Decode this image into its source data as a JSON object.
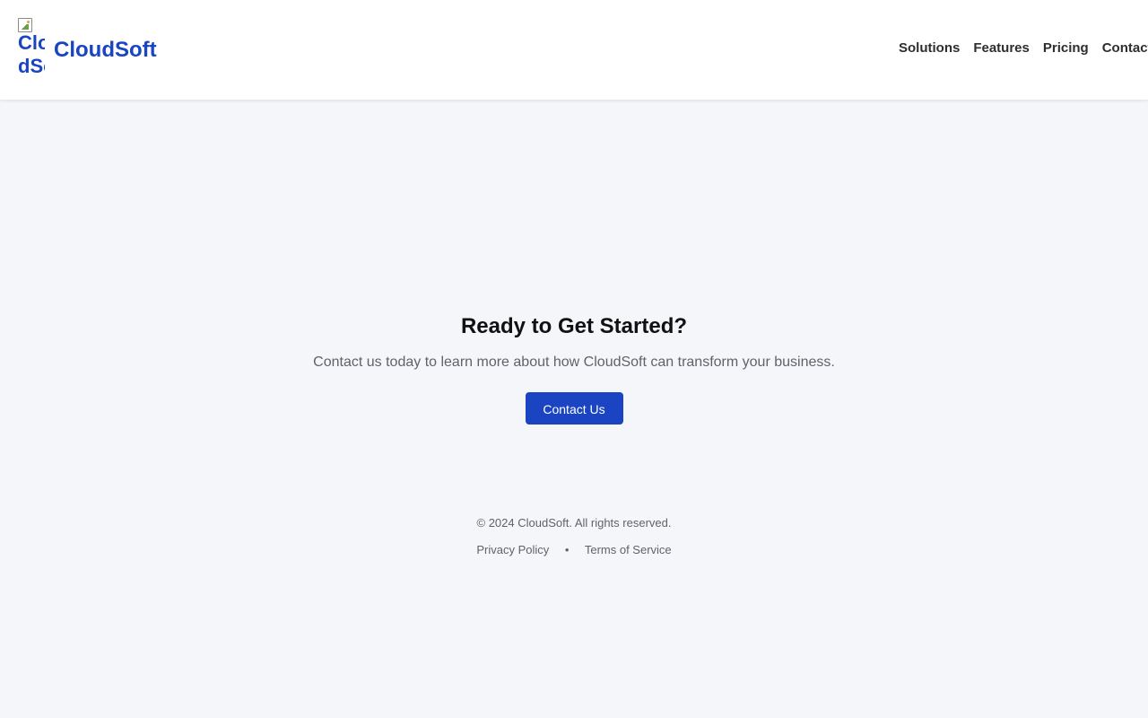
{
  "header": {
    "logo_alt": "CloudSoft Icon",
    "brand_name": "CloudSoft",
    "nav": [
      "Solutions",
      "Features",
      "Pricing",
      "Contact"
    ]
  },
  "cta": {
    "title": "Ready to Get Started?",
    "text": "Contact us today to learn more about how CloudSoft can transform your business.",
    "button_label": "Contact Us"
  },
  "footer": {
    "copyright": "© 2024 CloudSoft. All rights reserved.",
    "links": [
      "Privacy Policy",
      "Terms of Service"
    ],
    "separator": "•"
  },
  "colors": {
    "brand": "#1a44c2",
    "background": "#f4f6fa",
    "header_bg": "#ffffff",
    "muted_text": "#5f6368",
    "nav_text": "#2e2e2e"
  },
  "icons": {
    "logo": "broken-image-icon"
  }
}
